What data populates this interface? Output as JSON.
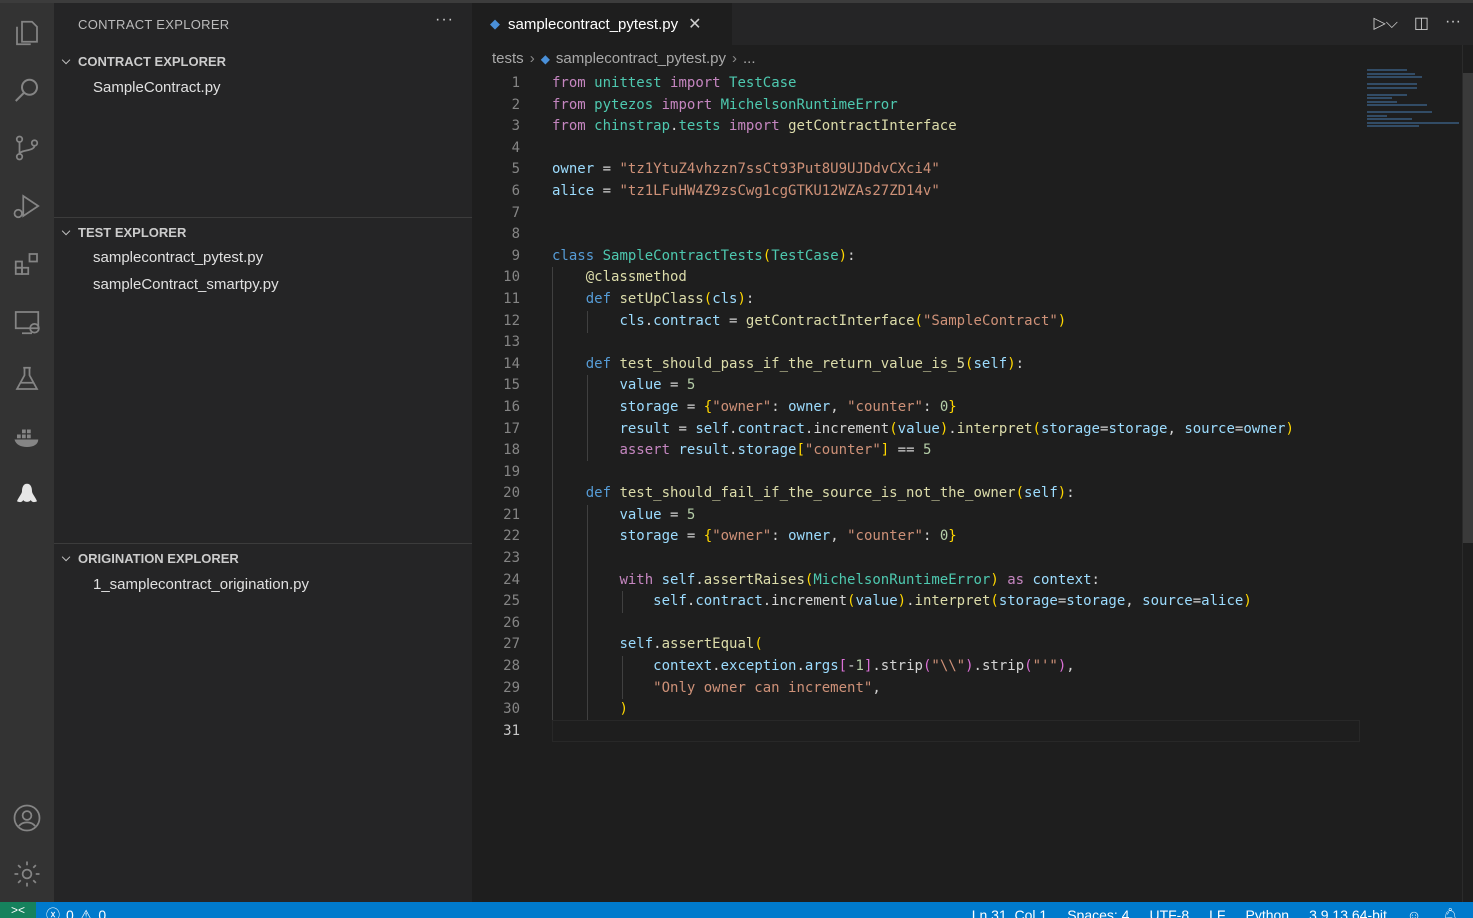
{
  "activity_bar": {
    "icons": [
      "explorer-icon",
      "search-icon",
      "source-control-icon",
      "run-debug-icon",
      "extensions-icon",
      "remote-explorer-icon",
      "testing-icon",
      "docker-icon",
      "chinstrap-icon",
      "account-icon",
      "settings-gear-icon"
    ]
  },
  "sidebar": {
    "title": "CONTRACT EXPLORER",
    "more": "···",
    "sections": [
      {
        "title": "CONTRACT EXPLORER",
        "items": [
          "SampleContract.py"
        ]
      },
      {
        "title": "TEST EXPLORER",
        "items": [
          "samplecontract_pytest.py",
          "sampleContract_smartpy.py"
        ]
      },
      {
        "title": "ORIGINATION EXPLORER",
        "items": [
          "1_samplecontract_origination.py"
        ]
      }
    ]
  },
  "editor": {
    "tab": {
      "label": "samplecontract_pytest.py",
      "close": "✕"
    },
    "breadcrumb": {
      "folder": "tests",
      "file": "samplecontract_pytest.py",
      "symbol": "..."
    },
    "active_line": 31,
    "line_count": 31
  },
  "status_bar": {
    "remote": "><",
    "errors": "0",
    "warnings": "0",
    "position": "Ln 31, Col 1",
    "spaces": "Spaces: 4",
    "encoding": "UTF-8",
    "eol": "LF",
    "language": "Python",
    "interpreter": "3.9.13 64-bit"
  },
  "colors": {
    "status_bar": "#007acc",
    "remote": "#16825d",
    "sidebar": "#252526",
    "editor": "#1e1e1e"
  }
}
